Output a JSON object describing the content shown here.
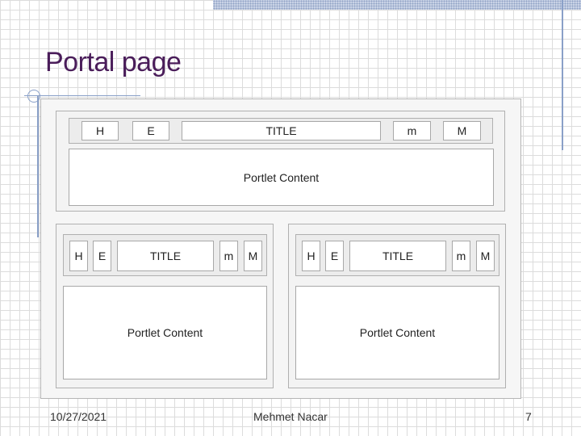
{
  "slide": {
    "title": "Portal page",
    "footer": {
      "date": "10/27/2021",
      "author": "Mehmet Nacar",
      "page_number": "7"
    }
  },
  "portlets": [
    {
      "buttons": {
        "h": "H",
        "e": "E",
        "title": "TITLE",
        "min": "m",
        "max": "M"
      },
      "content": "Portlet Content"
    },
    {
      "buttons": {
        "h": "H",
        "e": "E",
        "title": "TITLE",
        "min": "m",
        "max": "M"
      },
      "content": "Portlet Content"
    },
    {
      "buttons": {
        "h": "H",
        "e": "E",
        "title": "TITLE",
        "min": "m",
        "max": "M"
      },
      "content": "Portlet Content"
    }
  ]
}
